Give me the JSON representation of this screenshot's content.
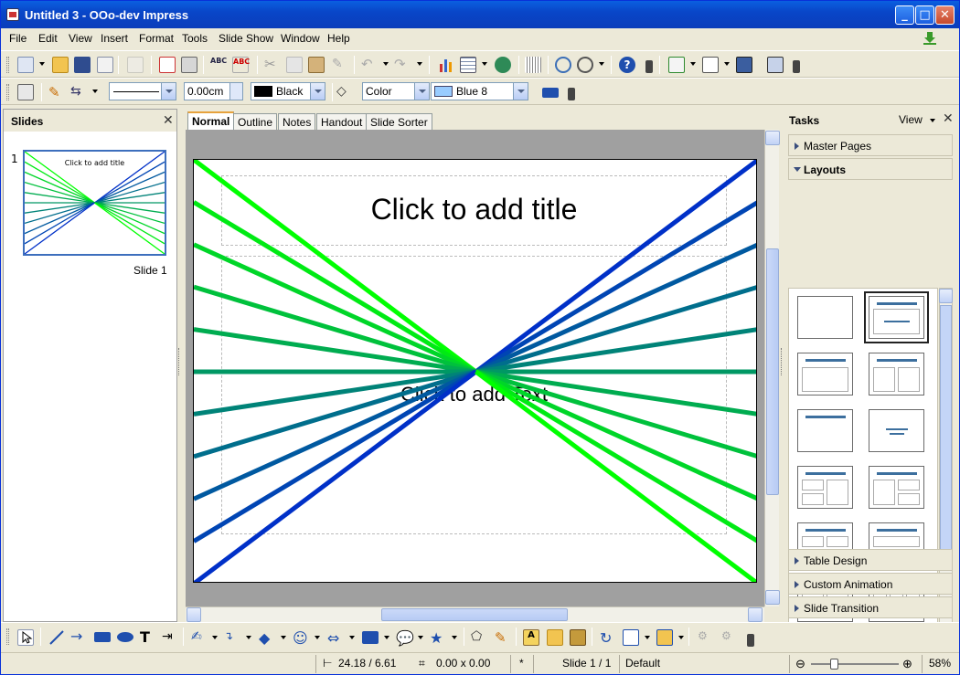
{
  "window": {
    "title": "Untitled 3 - OOo-dev Impress"
  },
  "menu": [
    "File",
    "Edit",
    "View",
    "Insert",
    "Format",
    "Tools",
    "Slide Show",
    "Window",
    "Help"
  ],
  "line_props": {
    "width_value": "0.00cm",
    "line_color": "Black",
    "area_style": "Color",
    "area_color": "Blue 8"
  },
  "slides_panel": {
    "title": "Slides",
    "thumb_number": "1",
    "thumb_label": "Slide 1",
    "thumb_title": "Click to add title"
  },
  "view_tabs": [
    "Normal",
    "Outline",
    "Notes",
    "Handout",
    "Slide Sorter"
  ],
  "slide": {
    "title_placeholder": "Click to add title",
    "text_placeholder": "Click to add Text"
  },
  "tasks": {
    "title": "Tasks",
    "view_label": "View",
    "master_pages": "Master Pages",
    "layouts": "Layouts",
    "table_design": "Table Design",
    "custom_animation": "Custom Animation",
    "slide_transition": "Slide Transition"
  },
  "status": {
    "position": "24.18 / 6.61",
    "size": "0.00 x 0.00",
    "modified": "*",
    "slide": "Slide 1 / 1",
    "master": "Default",
    "zoom": "58%"
  }
}
